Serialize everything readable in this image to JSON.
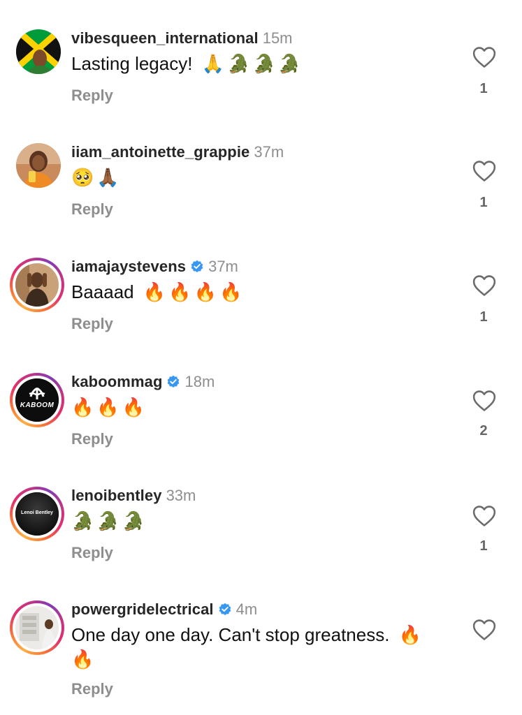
{
  "comments": [
    {
      "username": "vibesqueen_international",
      "verified": false,
      "time": "15m",
      "text": "Lasting legacy!",
      "emojis": [
        "🙏",
        "🐊",
        "🐊",
        "🐊"
      ],
      "reply_label": "Reply",
      "like_count": "1",
      "avatar": "jamaica-flag-avatar"
    },
    {
      "username": "iiam_antoinette_grappie",
      "verified": false,
      "time": "37m",
      "text": "",
      "emojis": [
        "🥺",
        "🙏🏾"
      ],
      "reply_label": "Reply",
      "like_count": "1",
      "avatar": "woman-selfie-avatar"
    },
    {
      "username": "iamajaystevens",
      "verified": true,
      "time": "37m",
      "text": "Baaaad",
      "emojis": [
        "🔥",
        "🔥",
        "🔥",
        "🔥"
      ],
      "reply_label": "Reply",
      "like_count": "1",
      "avatar": "man-portrait-avatar"
    },
    {
      "username": "kaboommag",
      "verified": true,
      "time": "18m",
      "text": "",
      "emojis": [
        "🔥",
        "🔥",
        "🔥"
      ],
      "reply_label": "Reply",
      "like_count": "2",
      "avatar": "kaboom-logo-avatar"
    },
    {
      "username": "lenoibentley",
      "verified": false,
      "time": "33m",
      "text": "",
      "emojis": [
        "🐊",
        "🐊",
        "🐊"
      ],
      "reply_label": "Reply",
      "like_count": "1",
      "avatar": "lenoi-bentley-avatar"
    },
    {
      "username": "powergridelectrical",
      "verified": true,
      "time": "4m",
      "text": "One day one day. Can't stop greatness.",
      "emojis": [
        "🔥",
        "🔥"
      ],
      "reply_label": "Reply",
      "like_count": "",
      "avatar": "electrician-avatar"
    }
  ],
  "avatar_texts": {
    "kaboom": "KABOOM",
    "lenoi": "Lenoi Bentley"
  },
  "colors": {
    "verified_blue": "#3897f0",
    "muted_text": "#8e8e8e",
    "story_ring": "#e1306c"
  }
}
